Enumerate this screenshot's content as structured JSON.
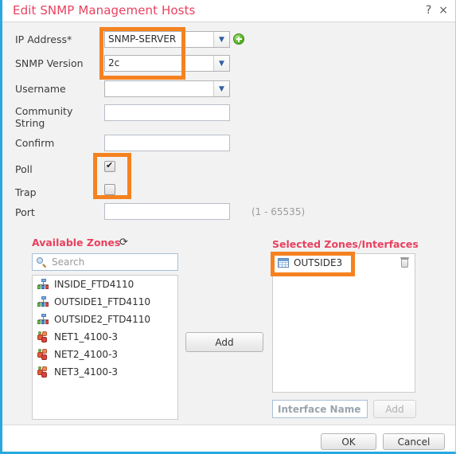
{
  "window": {
    "title": "Edit SNMP Management Hosts",
    "help_icon": "?",
    "close_icon": "×"
  },
  "form": {
    "ip_address": {
      "label": "IP Address*",
      "value": "SNMP-SERVER",
      "arrow_icon": "▼",
      "add_icon": "plus-circle-icon"
    },
    "snmp_version": {
      "label": "SNMP Version",
      "value": "2c",
      "arrow_icon": "▼"
    },
    "username": {
      "label": "Username",
      "value": "",
      "arrow_icon": "▼"
    },
    "community_string": {
      "label": "Community String",
      "label_line1": "Community",
      "label_line2": "String",
      "value": ""
    },
    "confirm": {
      "label": "Confirm",
      "value": ""
    },
    "poll": {
      "label": "Poll",
      "checked": true
    },
    "trap": {
      "label": "Trap",
      "checked": false
    },
    "port": {
      "label": "Port",
      "value": "",
      "hint": "(1 - 65535)"
    }
  },
  "zones": {
    "available": {
      "title": "Available Zones",
      "refresh_icon": "⟳",
      "search_placeholder": "Search",
      "search_value": "",
      "items": [
        {
          "label": "INSIDE_FTD4110",
          "icon": "zone-icon"
        },
        {
          "label": "OUTSIDE1_FTD4110",
          "icon": "zone-icon"
        },
        {
          "label": "OUTSIDE2_FTD4110",
          "icon": "zone-icon"
        },
        {
          "label": "NET1_4100-3",
          "icon": "interface-group-icon"
        },
        {
          "label": "NET2_4100-3",
          "icon": "interface-group-icon"
        },
        {
          "label": "NET3_4100-3",
          "icon": "interface-group-icon"
        }
      ]
    },
    "add_button": "Add",
    "selected": {
      "title": "Selected Zones/Interfaces",
      "items": [
        {
          "label": "OUTSIDE3",
          "icon": "grid-icon",
          "delete_icon": "trash-icon"
        }
      ],
      "interface_name_placeholder": "Interface Name",
      "interface_name_value": "",
      "add_button": "Add"
    }
  },
  "footer": {
    "ok_label": "OK",
    "cancel_label": "Cancel"
  },
  "colors": {
    "accent_border": "#29a8df",
    "title_red": "#e8415f",
    "highlight_orange": "#f58220",
    "dialog_bg": "#f2f2f2"
  }
}
